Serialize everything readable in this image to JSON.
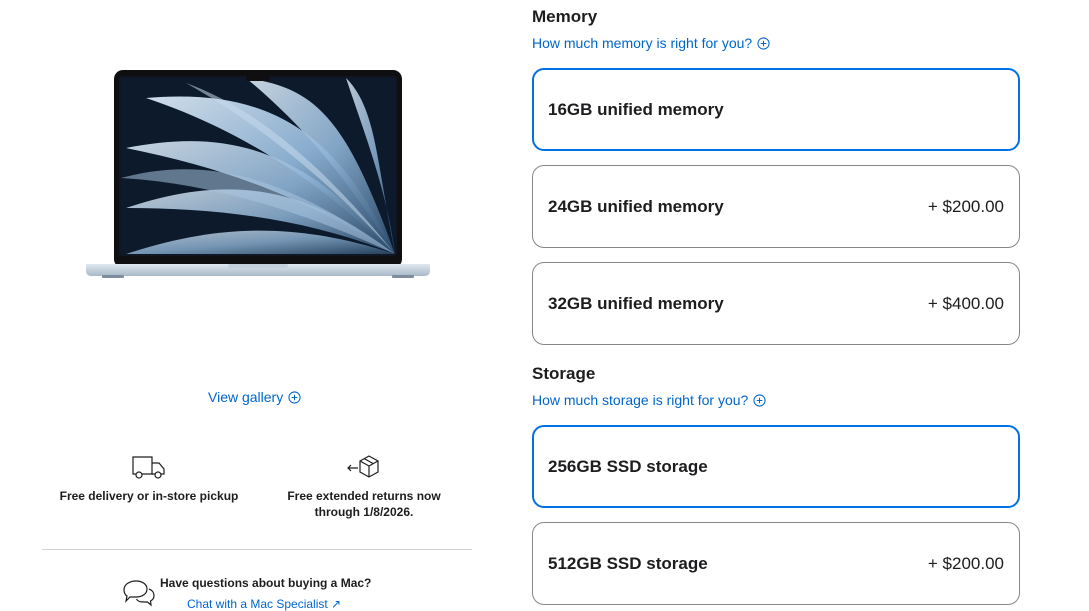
{
  "gallery": {
    "view_label": "View gallery"
  },
  "perks": {
    "delivery": "Free delivery or in-store pickup",
    "returns_line1": "Free extended returns now",
    "returns_line2": "through 1/8/2026."
  },
  "help": {
    "question": "Have questions about buying a Mac?",
    "chat_link": "Chat with a Mac Specialist ↗"
  },
  "memory": {
    "title": "Memory",
    "help_link": "How much memory is right for you?",
    "options": [
      {
        "label": "16GB unified memory",
        "price": "",
        "selected": true
      },
      {
        "label": "24GB unified memory",
        "price": "+ $200.00",
        "selected": false
      },
      {
        "label": "32GB unified memory",
        "price": "+ $400.00",
        "selected": false
      }
    ]
  },
  "storage": {
    "title": "Storage",
    "help_link": "How much storage is right for you?",
    "options": [
      {
        "label": "256GB SSD storage",
        "price": "",
        "selected": true
      },
      {
        "label": "512GB SSD storage",
        "price": "+ $200.00",
        "selected": false
      }
    ]
  },
  "colors": {
    "link": "#0066cc",
    "selected_border": "#0071e3",
    "border": "#86868b",
    "text": "#1d1d1f"
  },
  "icons": [
    "laptop-image",
    "plus-circle-icon",
    "delivery-truck-icon",
    "return-box-icon",
    "chat-bubbles-icon"
  ]
}
